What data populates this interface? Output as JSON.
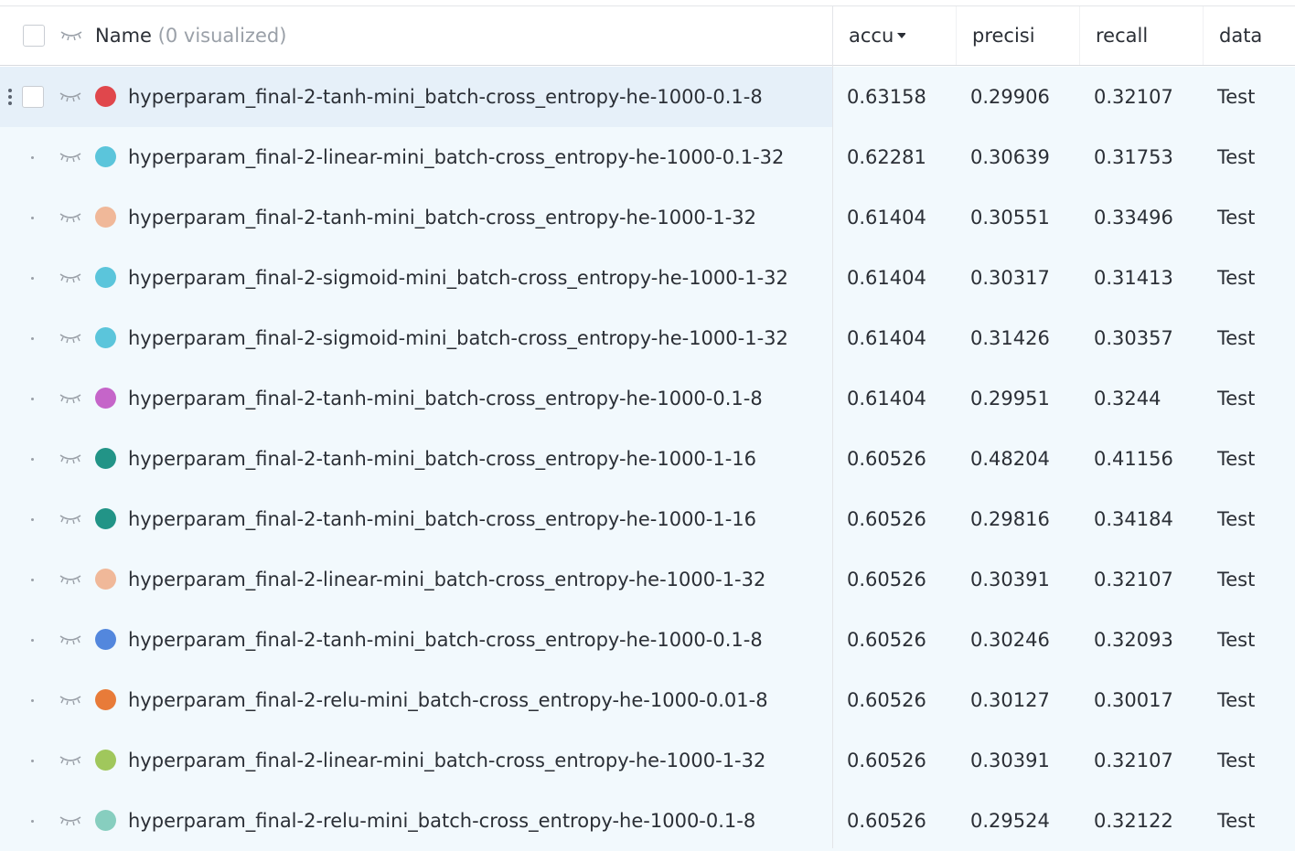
{
  "header": {
    "name_label": "Name",
    "visualized_label": "(0 visualized)",
    "columns": [
      "accu",
      "precisi",
      "recall",
      "data"
    ]
  },
  "rows": [
    {
      "name": "hyperparam_final-2-tanh-mini_batch-cross_entropy-he-1000-0.1-8",
      "color": "#e0474c",
      "acc": "0.63158",
      "prec": "0.29906",
      "rec": "0.32107",
      "data": "Test",
      "selected": true
    },
    {
      "name": "hyperparam_final-2-linear-mini_batch-cross_entropy-he-1000-0.1-32",
      "color": "#5bc5db",
      "acc": "0.62281",
      "prec": "0.30639",
      "rec": "0.31753",
      "data": "Test"
    },
    {
      "name": "hyperparam_final-2-tanh-mini_batch-cross_entropy-he-1000-1-32",
      "color": "#f0b899",
      "acc": "0.61404",
      "prec": "0.30551",
      "rec": "0.33496",
      "data": "Test"
    },
    {
      "name": "hyperparam_final-2-sigmoid-mini_batch-cross_entropy-he-1000-1-32",
      "color": "#5bc5db",
      "acc": "0.61404",
      "prec": "0.30317",
      "rec": "0.31413",
      "data": "Test"
    },
    {
      "name": "hyperparam_final-2-sigmoid-mini_batch-cross_entropy-he-1000-1-32",
      "color": "#5bc5db",
      "acc": "0.61404",
      "prec": "0.31426",
      "rec": "0.30357",
      "data": "Test"
    },
    {
      "name": "hyperparam_final-2-tanh-mini_batch-cross_entropy-he-1000-0.1-8",
      "color": "#c565c9",
      "acc": "0.61404",
      "prec": "0.29951",
      "rec": "0.3244",
      "data": "Test"
    },
    {
      "name": "hyperparam_final-2-tanh-mini_batch-cross_entropy-he-1000-1-16",
      "color": "#229487",
      "acc": "0.60526",
      "prec": "0.48204",
      "rec": "0.41156",
      "data": "Test"
    },
    {
      "name": "hyperparam_final-2-tanh-mini_batch-cross_entropy-he-1000-1-16",
      "color": "#229487",
      "acc": "0.60526",
      "prec": "0.29816",
      "rec": "0.34184",
      "data": "Test"
    },
    {
      "name": "hyperparam_final-2-linear-mini_batch-cross_entropy-he-1000-1-32",
      "color": "#f0b899",
      "acc": "0.60526",
      "prec": "0.30391",
      "rec": "0.32107",
      "data": "Test"
    },
    {
      "name": "hyperparam_final-2-tanh-mini_batch-cross_entropy-he-1000-0.1-8",
      "color": "#5387dd",
      "acc": "0.60526",
      "prec": "0.30246",
      "rec": "0.32093",
      "data": "Test"
    },
    {
      "name": "hyperparam_final-2-relu-mini_batch-cross_entropy-he-1000-0.01-8",
      "color": "#e87b39",
      "acc": "0.60526",
      "prec": "0.30127",
      "rec": "0.30017",
      "data": "Test"
    },
    {
      "name": "hyperparam_final-2-linear-mini_batch-cross_entropy-he-1000-1-32",
      "color": "#a0c75c",
      "acc": "0.60526",
      "prec": "0.30391",
      "rec": "0.32107",
      "data": "Test"
    },
    {
      "name": "hyperparam_final-2-relu-mini_batch-cross_entropy-he-1000-0.1-8",
      "color": "#87cebf",
      "acc": "0.60526",
      "prec": "0.29524",
      "rec": "0.32122",
      "data": "Test"
    }
  ]
}
